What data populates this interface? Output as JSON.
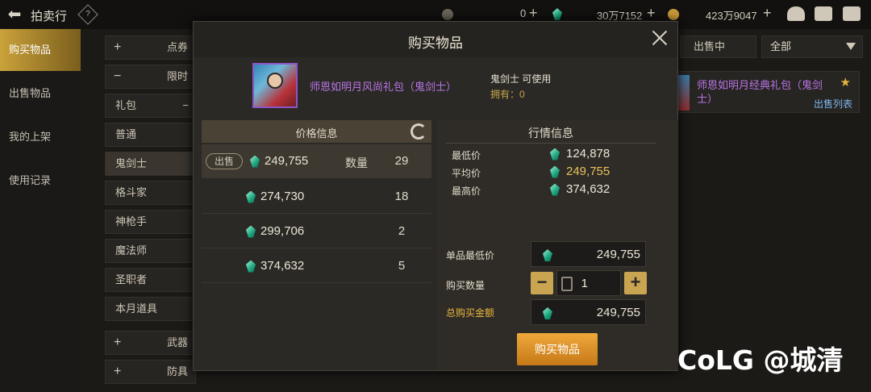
{
  "topbar": {
    "title": "拍卖行",
    "help_icon": "?",
    "currency1_value": "0",
    "currency2_value": "30万7152",
    "currency3_value": "423万9047"
  },
  "sidebar": {
    "items": [
      {
        "label": "购买物品",
        "active": true
      },
      {
        "label": "出售物品",
        "active": false
      },
      {
        "label": "我的上架",
        "active": false
      },
      {
        "label": "使用记录",
        "active": false
      }
    ]
  },
  "categories": [
    {
      "label": "点券",
      "prefix": "+"
    },
    {
      "label": "限时",
      "prefix": "−"
    },
    {
      "label": "礼包",
      "suffix": "−"
    },
    {
      "label": "普通"
    },
    {
      "label": "鬼剑士"
    },
    {
      "label": "格斗家"
    },
    {
      "label": "神枪手"
    },
    {
      "label": "魔法师"
    },
    {
      "label": "圣职者"
    },
    {
      "label": "本月道具"
    },
    {
      "label": "武器",
      "prefix": "+"
    },
    {
      "label": "防具",
      "prefix": "+"
    }
  ],
  "right_behind": {
    "status_label": "出售中",
    "filter_value": "全部",
    "card_name": "师恩如明月经典礼包（鬼剑士）",
    "card_link": "出售列表"
  },
  "modal": {
    "title": "购买物品",
    "item_name": "师恩如明月风尚礼包（鬼剑士）",
    "usable_text": "鬼剑士 可使用",
    "owned_text": "拥有：0",
    "price_info_title": "价格信息",
    "sell_tag": "出售",
    "qty_label": "数量",
    "price_rows": [
      {
        "price": "249,755",
        "qty": "29"
      },
      {
        "price": "274,730",
        "qty": "18"
      },
      {
        "price": "299,706",
        "qty": "2"
      },
      {
        "price": "374,632",
        "qty": "5"
      }
    ],
    "market": {
      "title": "行情信息",
      "min_label": "最低价",
      "min_value": "124,878",
      "avg_label": "平均价",
      "avg_value": "249,755",
      "max_label": "最高价",
      "max_value": "374,632"
    },
    "form": {
      "unit_min_label": "单品最低价",
      "unit_min_value": "249,755",
      "buy_qty_label": "购买数量",
      "buy_qty_value": "1",
      "total_label": "总购买金额",
      "total_value": "249,755",
      "minus": "−",
      "plus": "+"
    },
    "buy_button": "购买物品"
  },
  "watermark": "CoLG @城清",
  "colors": {
    "accent_gold": "#c9a551",
    "item_purple": "#b874e6",
    "buy_orange": "#e8952a"
  }
}
